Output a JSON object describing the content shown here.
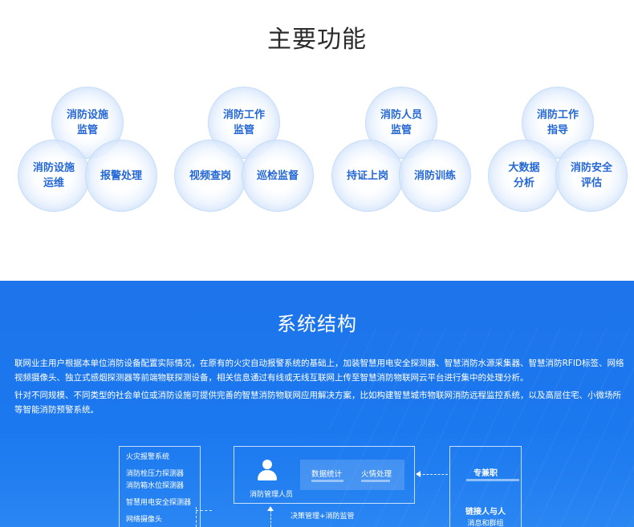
{
  "features": {
    "title": "主要功能",
    "groups": [
      {
        "top": "消防设施\n监管",
        "left": "消防设施\n运维",
        "right": "报警处理"
      },
      {
        "top": "消防工作\n监管",
        "left": "视频查岗",
        "right": "巡检监督"
      },
      {
        "top": "消防人员\n监管",
        "left": "持证上岗",
        "right": "消防训练"
      },
      {
        "top": "消防工作\n指导",
        "left": "大数据\n分析",
        "right": "消防安全\n评估"
      }
    ]
  },
  "system": {
    "title": "系统结构",
    "para1": "联网业主用户根据本单位消防设备配置实际情况，在原有的火灾自动报警系统的基础上，加装智慧用电安全探测器、智慧消防水源采集器、智慧消防RFID标签、网络视频摄像头、独立式感烟探测器等前端物联探测设备，相关信息通过有线或无线互联网上传至智慧消防物联网云平台进行集中的处理分析。",
    "para2": "针对不同规模、不同类型的社会单位或消防设施可提供完善的智慧消防物联网应用解决方案，比如构建智慧城市物联网消防远程监控系统，以及高层住宅、小微场所等智能消防预警系统。",
    "diagram": {
      "left_items": [
        "火灾报警系统",
        "消防栓压力探测器",
        "消防箱水位探测器",
        "智慧用电安全探测器",
        "网络摄像头"
      ],
      "manager_label": "消防管理人员",
      "stat_label": "数据统计",
      "fire_label": "火情处理",
      "below_center": "决策管理+消防监管",
      "right_title": "专兼职",
      "right_link": "链接人与人",
      "right_sub": "消息和群组"
    }
  }
}
